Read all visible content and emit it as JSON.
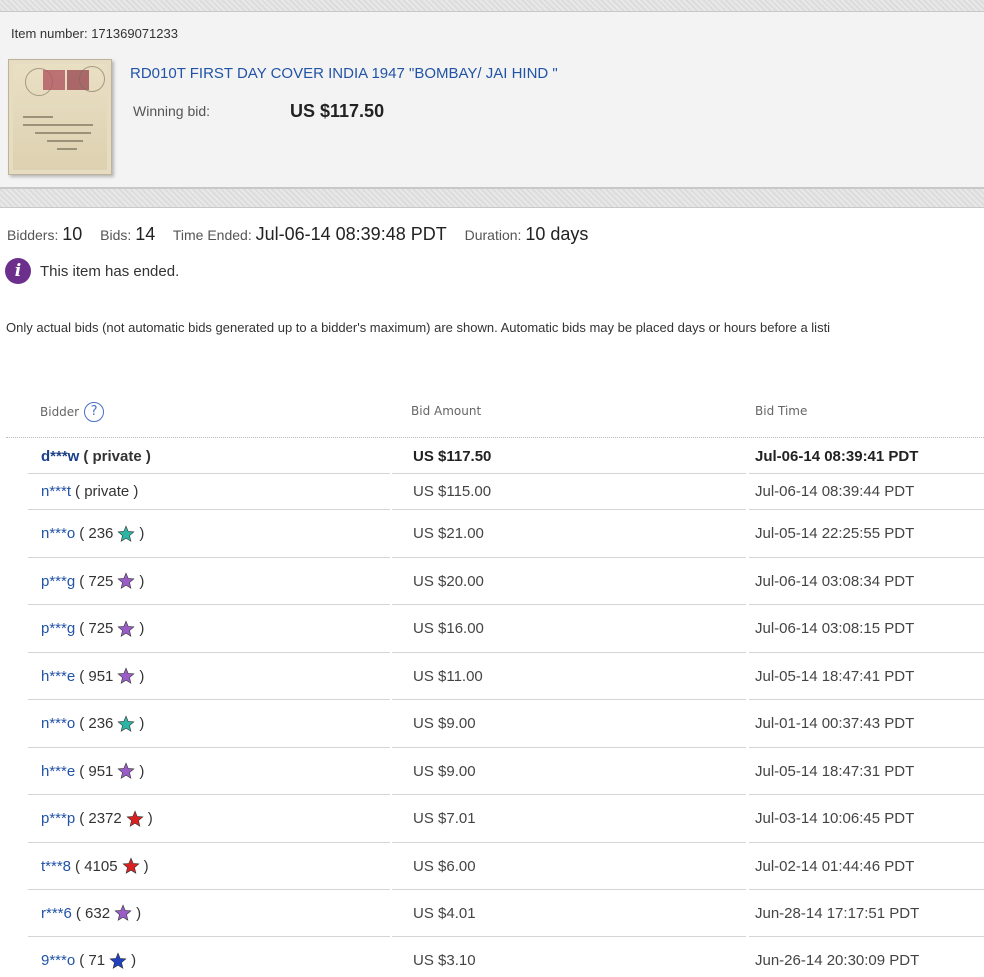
{
  "item": {
    "number_label": "Item number: 171369071233",
    "title": "RD010T FIRST DAY COVER INDIA 1947 \"BOMBAY/ JAI HIND \"",
    "winning_bid_label": "Winning bid:",
    "winning_bid_value": "US $117.50"
  },
  "stats": {
    "bidders_label": "Bidders:",
    "bidders_value": "10",
    "bids_label": "Bids:",
    "bids_value": "14",
    "time_ended_label": "Time Ended:",
    "time_ended_value": "Jul-06-14 08:39:48 PDT",
    "duration_label": "Duration:",
    "duration_value": "10 days"
  },
  "status": {
    "icon": "i",
    "message": "This item has ended."
  },
  "note": "Only actual bids (not automatic bids generated up to a bidder's maximum) are shown. Automatic bids may be placed days or hours before a listi",
  "table": {
    "headers": {
      "bidder": "Bidder",
      "help": "?",
      "amount": "Bid Amount",
      "time": "Bid Time"
    },
    "star_colors": {
      "turquoise": "#2bb5a5",
      "purple": "#9a5cc6",
      "red": "#d92121",
      "blue": "#2040c0"
    },
    "rows": [
      {
        "name": "d***w",
        "info": "( private )",
        "star": null,
        "amount": "US $117.50",
        "time": "Jul-06-14 08:39:41 PDT",
        "winner": true
      },
      {
        "name": "n***t",
        "info": "( private )",
        "star": null,
        "amount": "US $115.00",
        "time": "Jul-06-14 08:39:44 PDT"
      },
      {
        "name": "n***o",
        "info": "( 236",
        "info_close": ")",
        "star": "turquoise",
        "amount": "US $21.00",
        "time": "Jul-05-14 22:25:55 PDT"
      },
      {
        "name": "p***g",
        "info": "( 725",
        "info_close": ")",
        "star": "purple",
        "amount": "US $20.00",
        "time": "Jul-06-14 03:08:34 PDT"
      },
      {
        "name": "p***g",
        "info": "( 725",
        "info_close": ")",
        "star": "purple",
        "amount": "US $16.00",
        "time": "Jul-06-14 03:08:15 PDT"
      },
      {
        "name": "h***e",
        "info": "( 951",
        "info_close": ")",
        "star": "purple",
        "amount": "US $11.00",
        "time": "Jul-05-14 18:47:41 PDT"
      },
      {
        "name": "n***o",
        "info": "( 236",
        "info_close": ")",
        "star": "turquoise",
        "amount": "US $9.00",
        "time": "Jul-01-14 00:37:43 PDT"
      },
      {
        "name": "h***e",
        "info": "( 951",
        "info_close": ")",
        "star": "purple",
        "amount": "US $9.00",
        "time": "Jul-05-14 18:47:31 PDT"
      },
      {
        "name": "p***p",
        "info": "( 2372",
        "info_close": ")",
        "star": "red",
        "amount": "US $7.01",
        "time": "Jul-03-14 10:06:45 PDT"
      },
      {
        "name": "t***8",
        "info": "( 4105",
        "info_close": ")",
        "star": "red",
        "amount": "US $6.00",
        "time": "Jul-02-14 01:44:46 PDT"
      },
      {
        "name": "r***6",
        "info": "( 632",
        "info_close": ")",
        "star": "purple",
        "amount": "US $4.01",
        "time": "Jun-28-14 17:17:51 PDT"
      },
      {
        "name": "9***o",
        "info": "( 71",
        "info_close": ")",
        "star": "blue",
        "amount": "US $3.10",
        "time": "Jun-26-14 20:30:09 PDT"
      }
    ]
  }
}
